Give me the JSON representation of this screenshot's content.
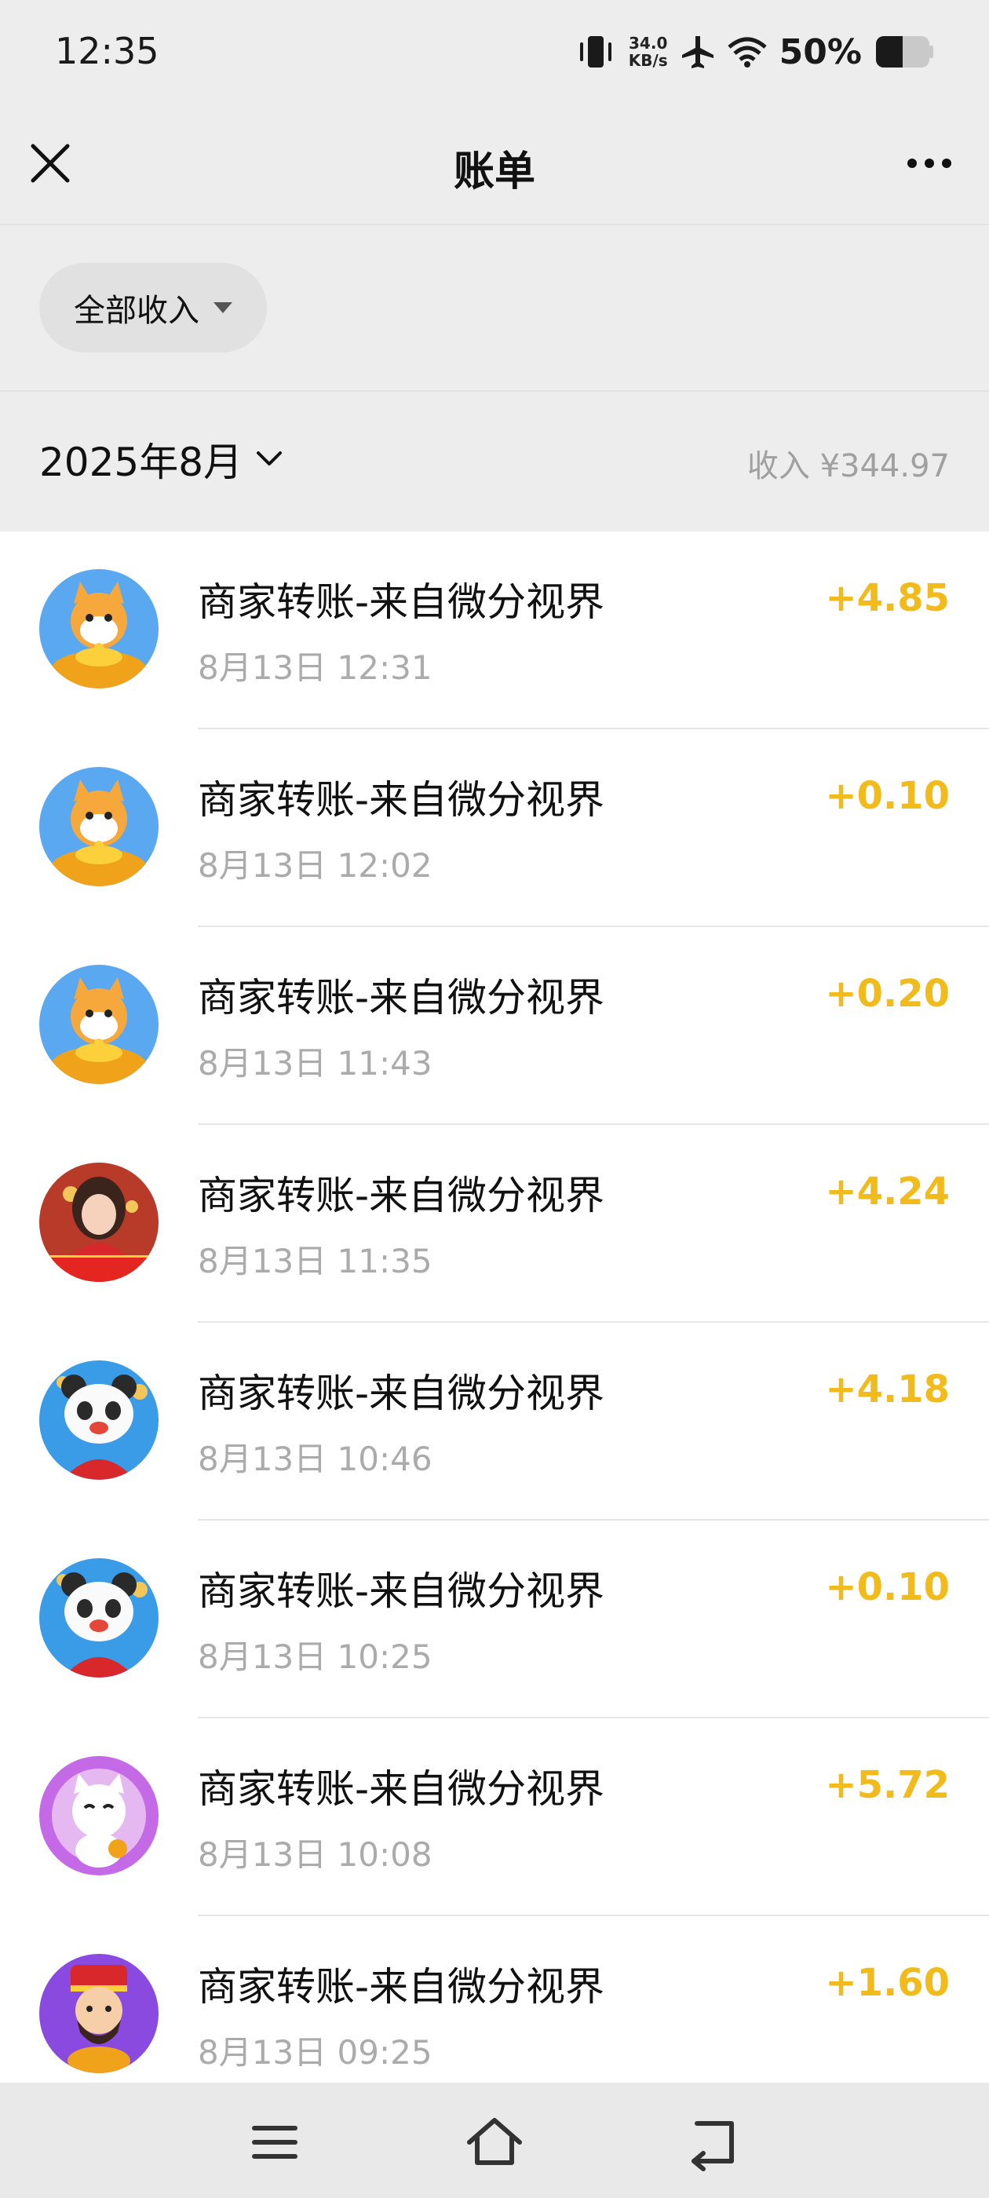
{
  "status": {
    "time": "12:35",
    "speed_value": "34.0",
    "speed_unit": "KB/s",
    "battery": "50%"
  },
  "nav": {
    "title": "账单"
  },
  "filter": {
    "label": "全部收入"
  },
  "month": {
    "label": "2025年8月",
    "income": "收入 ¥344.97"
  },
  "transactions": [
    {
      "title": "商家转账-来自微分视界",
      "time": "8月13日 12:31",
      "amount": "+4.85",
      "avatar": "lucky-cat-avatar"
    },
    {
      "title": "商家转账-来自微分视界",
      "time": "8月13日 12:02",
      "amount": "+0.10",
      "avatar": "lucky-cat-avatar"
    },
    {
      "title": "商家转账-来自微分视界",
      "time": "8月13日 11:43",
      "amount": "+0.20",
      "avatar": "lucky-cat-avatar"
    },
    {
      "title": "商家转账-来自微分视界",
      "time": "8月13日 11:35",
      "amount": "+4.24",
      "avatar": "woman-avatar"
    },
    {
      "title": "商家转账-来自微分视界",
      "time": "8月13日 10:46",
      "amount": "+4.18",
      "avatar": "panda-avatar"
    },
    {
      "title": "商家转账-来自微分视界",
      "time": "8月13日 10:25",
      "amount": "+0.10",
      "avatar": "panda-avatar"
    },
    {
      "title": "商家转账-来自微分视界",
      "time": "8月13日 10:08",
      "amount": "+5.72",
      "avatar": "white-cat-avatar"
    },
    {
      "title": "商家转账-来自微分视界",
      "time": "8月13日 09:25",
      "amount": "+1.60",
      "avatar": "fortune-god-avatar"
    }
  ],
  "colors": {
    "amount": "#f2bb1c",
    "background": "#ededed"
  }
}
